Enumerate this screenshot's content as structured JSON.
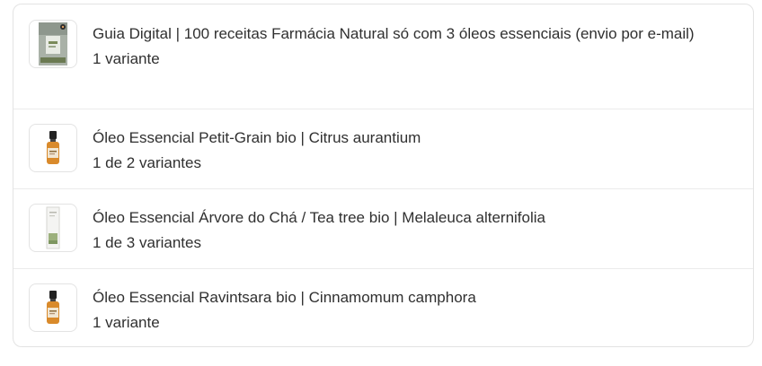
{
  "products": [
    {
      "title": "Guia Digital | 100 receitas Farmácia Natural só com 3 óleos essenciais (envio por e-mail)",
      "variants": "1 variante",
      "thumbnail_icon": "ebook-cover-icon"
    },
    {
      "title": "Óleo Essencial Petit-Grain bio | Citrus aurantium",
      "variants": "1 de 2 variantes",
      "thumbnail_icon": "amber-bottle-icon"
    },
    {
      "title": "Óleo Essencial Árvore do Chá / Tea tree bio | Melaleuca alternifolia",
      "variants": "1 de 3 variantes",
      "thumbnail_icon": "white-box-icon"
    },
    {
      "title": "Óleo Essencial Ravintsara bio | Cinnamomum camphora",
      "variants": "1 variante",
      "thumbnail_icon": "amber-bottle-icon"
    }
  ],
  "colors": {
    "border": "#e3e3e3",
    "text": "#303030",
    "bottle_amber": "#d98a2b",
    "bottle_cap": "#222222"
  }
}
